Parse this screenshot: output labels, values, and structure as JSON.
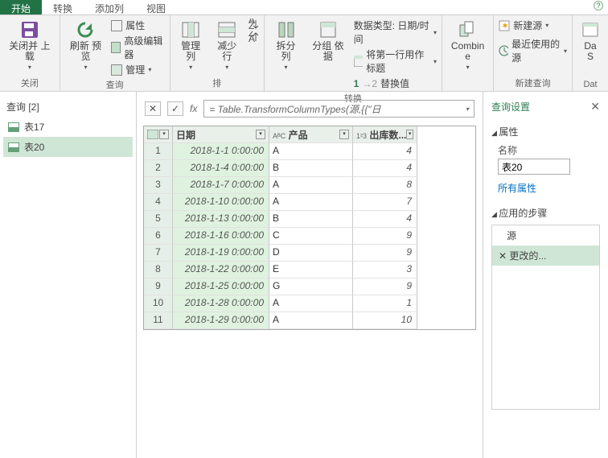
{
  "tabs": {
    "active": "开始",
    "others": [
      "转换",
      "添加列",
      "视图"
    ]
  },
  "ribbon": {
    "close": {
      "big": "关闭并\n上载",
      "label": "关闭"
    },
    "query": {
      "big": "刷新\n预览",
      "list": [
        "属性",
        "高级编辑器",
        "管理"
      ],
      "label": "查询"
    },
    "cols": {
      "b1": "管理\n列",
      "b2": "减少\n行",
      "label": "排"
    },
    "split": {
      "b1": "拆分\n列",
      "b2": "分组\n依据",
      "lines": [
        "数据类型: 日期/时间",
        "将第一行用作标题",
        "替换值"
      ],
      "label": "转换"
    },
    "combine": {
      "big": "Combin\ne",
      "label": ""
    },
    "source": {
      "l1": "新建源",
      "l2": "最近使用的源",
      "label": "新建查询"
    },
    "data": {
      "big": "Da\nS",
      "label": "Dat"
    }
  },
  "nav": {
    "title": "查询 [2]",
    "items": [
      "表17",
      "表20"
    ],
    "selected": 1
  },
  "fx": "= Table.TransformColumnTypes(源,{{\"日",
  "columns": [
    "",
    "日期",
    "产品",
    "出库数..."
  ],
  "colprefix": [
    "",
    "",
    "AᴮC",
    "1²3"
  ],
  "rows": [
    {
      "n": 1,
      "date": "2018-1-1 0:00:00",
      "prod": "A",
      "qty": 4
    },
    {
      "n": 2,
      "date": "2018-1-4 0:00:00",
      "prod": "B",
      "qty": 4
    },
    {
      "n": 3,
      "date": "2018-1-7 0:00:00",
      "prod": "A",
      "qty": 8
    },
    {
      "n": 4,
      "date": "2018-1-10 0:00:00",
      "prod": "A",
      "qty": 7
    },
    {
      "n": 5,
      "date": "2018-1-13 0:00:00",
      "prod": "B",
      "qty": 4
    },
    {
      "n": 6,
      "date": "2018-1-16 0:00:00",
      "prod": "C",
      "qty": 9
    },
    {
      "n": 7,
      "date": "2018-1-19 0:00:00",
      "prod": "D",
      "qty": 9
    },
    {
      "n": 8,
      "date": "2018-1-22 0:00:00",
      "prod": "E",
      "qty": 3
    },
    {
      "n": 9,
      "date": "2018-1-25 0:00:00",
      "prod": "G",
      "qty": 9
    },
    {
      "n": 10,
      "date": "2018-1-28 0:00:00",
      "prod": "A",
      "qty": 1
    },
    {
      "n": 11,
      "date": "2018-1-29 0:00:00",
      "prod": "A",
      "qty": 10
    }
  ],
  "settings": {
    "title": "查询设置",
    "prop_section": "属性",
    "name_label": "名称",
    "name_value": "表20",
    "all_props": "所有属性",
    "steps_section": "应用的步骤",
    "steps": [
      "源",
      "更改的..."
    ],
    "step_sel": 1
  }
}
